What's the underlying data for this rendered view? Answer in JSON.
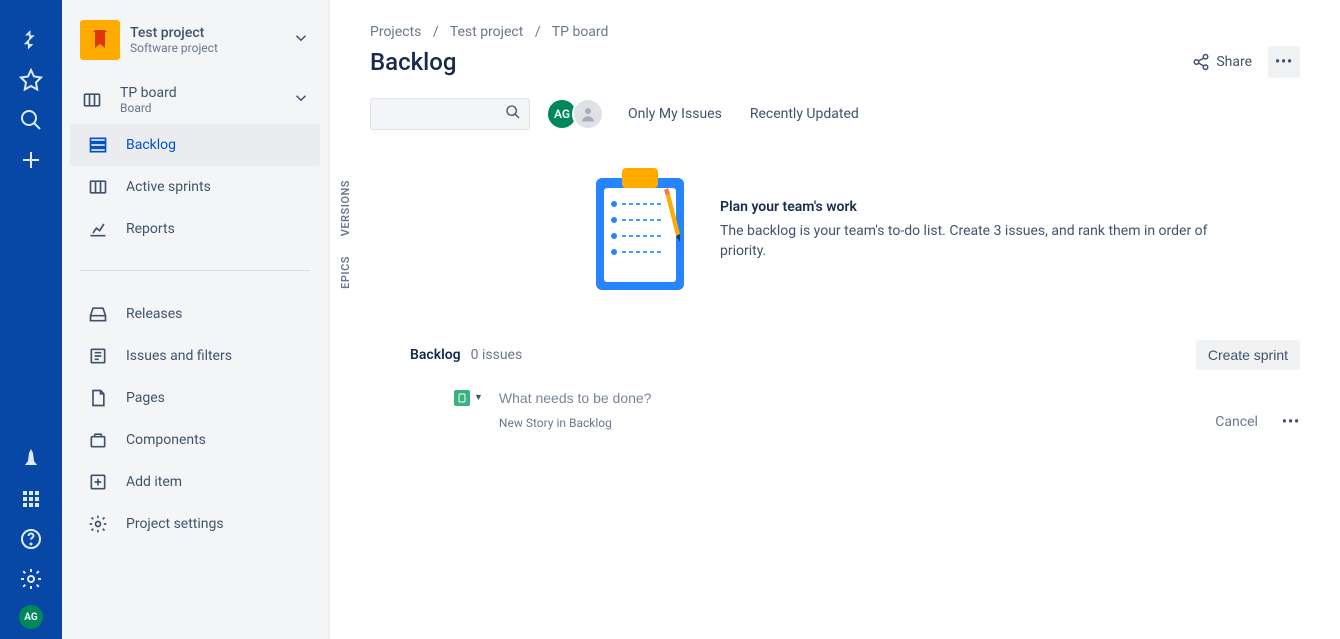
{
  "globalNav": {
    "avatarInitials": "AG"
  },
  "project": {
    "name": "Test project",
    "type": "Software project"
  },
  "board": {
    "name": "TP board",
    "sub": "Board"
  },
  "sidebar": {
    "backlog": "Backlog",
    "activeSprints": "Active sprints",
    "reports": "Reports",
    "releases": "Releases",
    "issuesFilters": "Issues and filters",
    "pages": "Pages",
    "components": "Components",
    "addItem": "Add item",
    "projectSettings": "Project settings"
  },
  "breadcrumbs": {
    "a": "Projects",
    "b": "Test project",
    "c": "TP board"
  },
  "page": {
    "title": "Backlog",
    "share": "Share"
  },
  "toolbar": {
    "avatarInitials": "AG",
    "onlyMy": "Only My Issues",
    "recently": "Recently Updated"
  },
  "vtabs": {
    "versions": "VERSIONS",
    "epics": "EPICS"
  },
  "empty": {
    "title": "Plan your team's work",
    "body": "The backlog is your team's to-do list. Create 3 issues, and rank them in order of priority."
  },
  "backlog": {
    "title": "Backlog",
    "count": "0 issues",
    "createSprint": "Create sprint"
  },
  "issue": {
    "placeholder": "What needs to be done?",
    "sub": "New Story in Backlog",
    "cancel": "Cancel"
  }
}
